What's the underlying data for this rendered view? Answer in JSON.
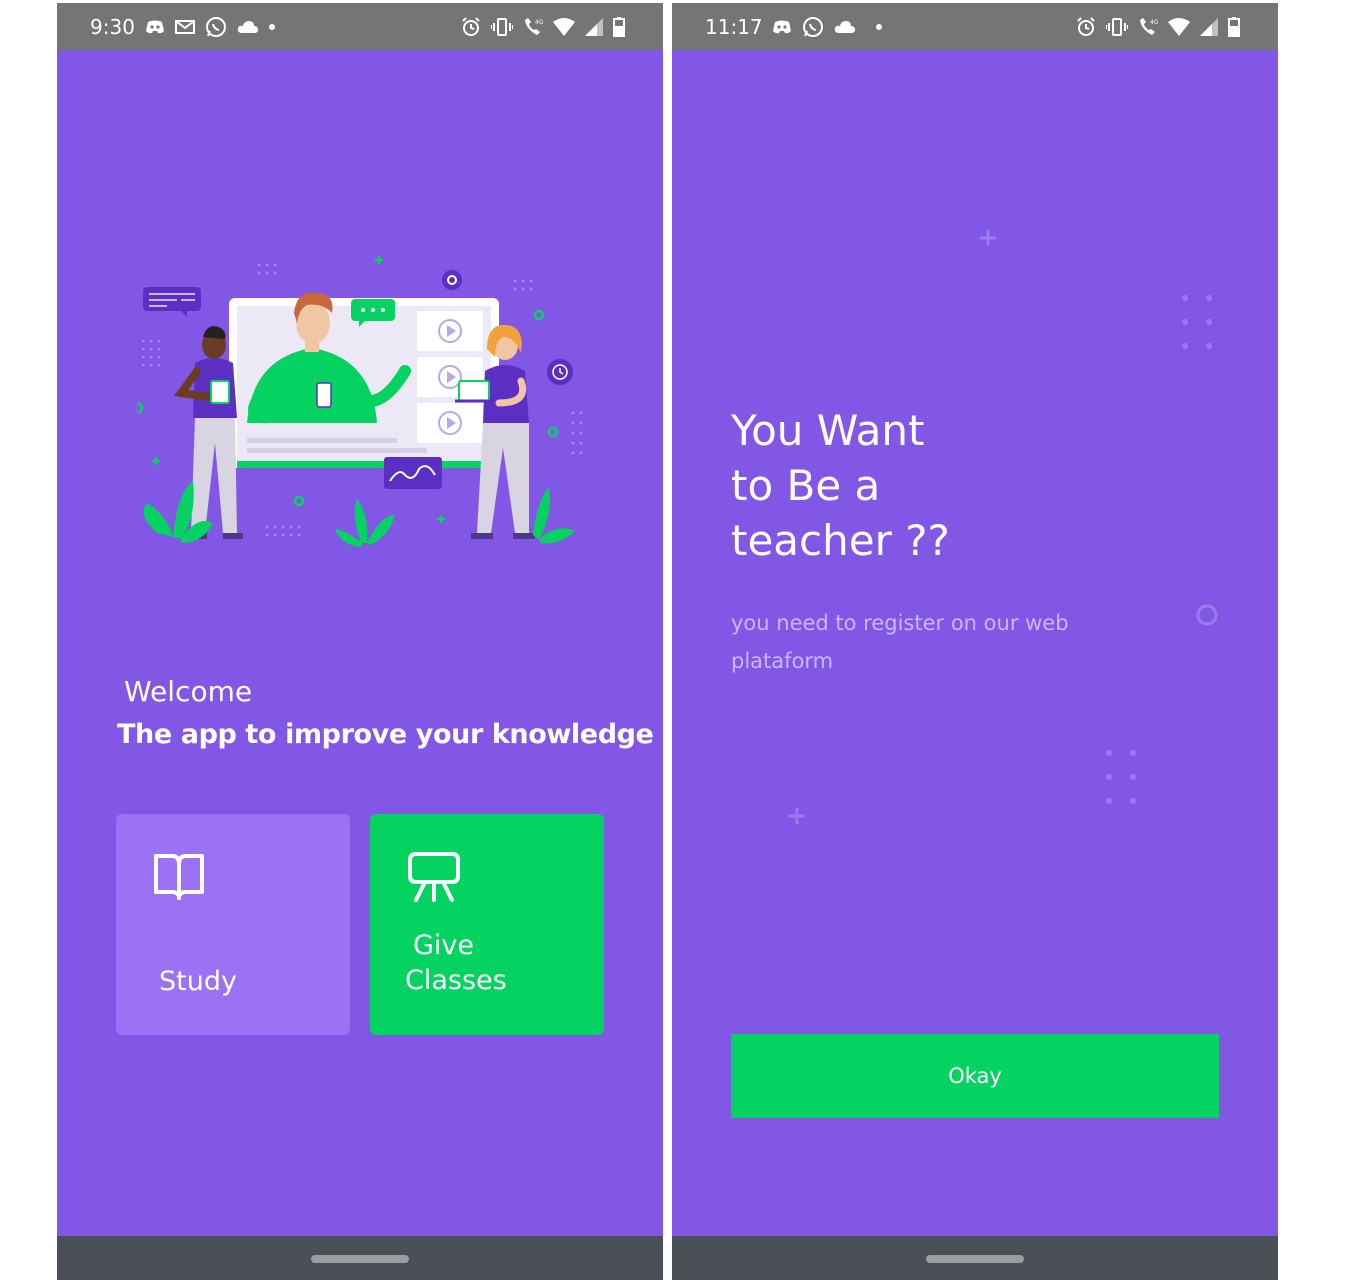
{
  "left_screen": {
    "status_bar": {
      "time": "9:30",
      "left_icons": [
        "discord-icon",
        "mail-icon",
        "whatsapp-icon",
        "cloud-icon",
        "dot-icon"
      ],
      "right_icons": [
        "alarm-icon",
        "vibrate-icon",
        "wifi-call-icon",
        "wifi-icon",
        "signal-icon",
        "battery-icon"
      ]
    },
    "welcome": "Welcome",
    "tagline": "The app to improve your knowledge",
    "options": {
      "study_label": "Study",
      "study_icon": "book-icon",
      "give_line1": "Give",
      "give_line2": "Classes",
      "give_icon": "presentation-icon"
    }
  },
  "right_screen": {
    "status_bar": {
      "time": "11:17",
      "left_icons": [
        "discord-icon",
        "whatsapp-icon",
        "cloud-icon",
        "dot-icon"
      ],
      "right_icons": [
        "alarm-icon",
        "vibrate-icon",
        "wifi-call-icon",
        "wifi-icon",
        "signal-icon",
        "battery-icon"
      ]
    },
    "title_line1": "You Want",
    "title_line2": "to Be a",
    "title_line3": "teacher ??",
    "message": "you need to register on our web plataform",
    "okay_label": "Okay"
  },
  "colors": {
    "background_purple": "#8257e6",
    "light_purple": "#9a72f3",
    "green": "#04d361",
    "status_bar": "#757575",
    "nav_bar": "#4b4f56"
  }
}
